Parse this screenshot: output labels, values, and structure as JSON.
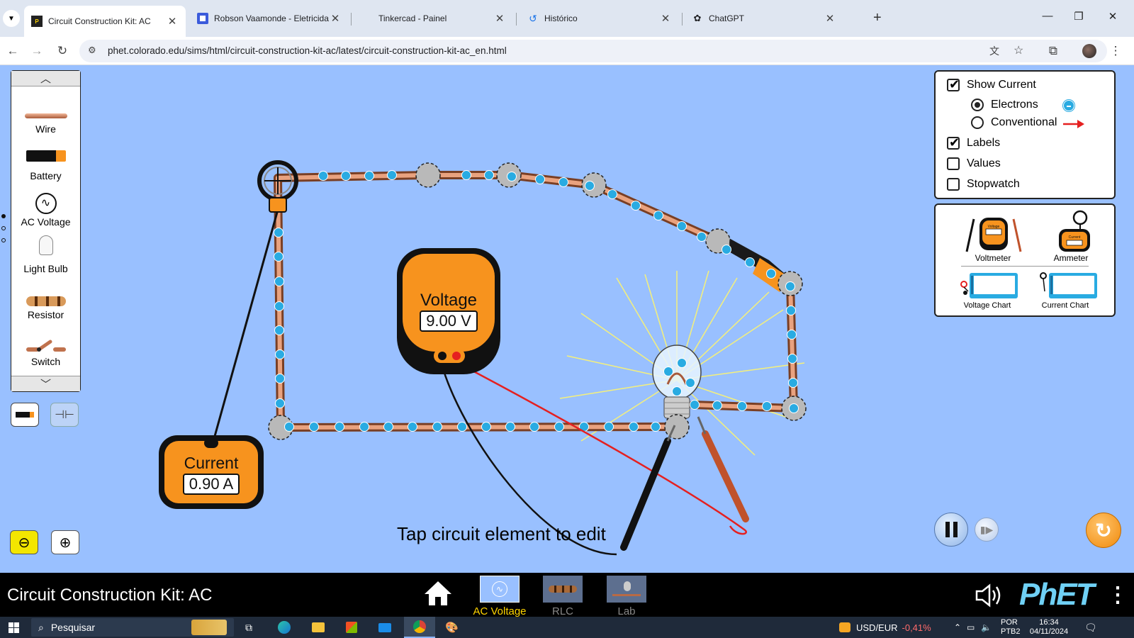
{
  "browser": {
    "tabs": [
      {
        "title": "Circuit Construction Kit: AC",
        "active": true
      },
      {
        "title": "Robson Vaamonde - Eletricidad"
      },
      {
        "title": "Tinkercad - Painel"
      },
      {
        "title": "Histórico"
      },
      {
        "title": "ChatGPT"
      }
    ],
    "url": "phet.colorado.edu/sims/html/circuit-construction-kit-ac/latest/circuit-construction-kit-ac_en.html"
  },
  "toolbox": {
    "items": [
      {
        "label": "Wire",
        "icon": "wire-icon"
      },
      {
        "label": "Battery",
        "icon": "battery-icon"
      },
      {
        "label": "AC Voltage",
        "icon": "ac-voltage-icon"
      },
      {
        "label": "Light Bulb",
        "icon": "light-bulb-icon"
      },
      {
        "label": "Resistor",
        "icon": "resistor-icon"
      },
      {
        "label": "Switch",
        "icon": "switch-icon"
      }
    ]
  },
  "control_panel": {
    "show_current": {
      "label": "Show Current",
      "checked": true
    },
    "electrons": {
      "label": "Electrons",
      "selected": true
    },
    "conventional": {
      "label": "Conventional",
      "selected": false
    },
    "labels": {
      "label": "Labels",
      "checked": true
    },
    "values": {
      "label": "Values",
      "checked": false
    },
    "stopwatch": {
      "label": "Stopwatch",
      "checked": false
    }
  },
  "sensors": {
    "voltmeter": "Voltmeter",
    "ammeter": "Ammeter",
    "voltage_chart": "Voltage Chart",
    "current_chart": "Current Chart",
    "voltmeter_icon_text": "Voltage",
    "ammeter_icon_text": "Current"
  },
  "voltmeter": {
    "title": "Voltage",
    "reading": "9.00 V"
  },
  "ammeter": {
    "title": "Current",
    "reading": "0.90 A"
  },
  "hint": "Tap circuit element to edit",
  "navbar": {
    "sim_title": "Circuit Construction Kit: AC",
    "screens": [
      {
        "label": "AC Voltage",
        "active": true
      },
      {
        "label": "RLC"
      },
      {
        "label": "Lab"
      }
    ],
    "brand": "PhET"
  },
  "taskbar": {
    "search_placeholder": "Pesquisar",
    "currency_label": "USD/EUR",
    "currency_change": "-0,41%",
    "lang_top": "POR",
    "lang_bottom": "PTB2",
    "time": "16:34",
    "date": "04/11/2024"
  },
  "colors": {
    "sim_background": "#99c0ff",
    "meter_orange": "#f7931e",
    "electron_blue": "#29abe2",
    "active_screen": "#ffd400",
    "currency_negative": "#ff6b6b"
  }
}
